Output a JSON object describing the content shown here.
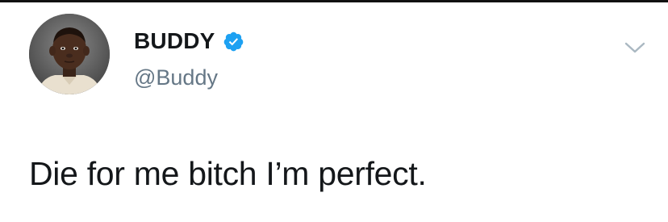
{
  "tweet": {
    "author": {
      "display_name": "BUDDY",
      "handle": "@Buddy",
      "verified": true,
      "avatar_icon": "profile-photo"
    },
    "text": "Die for me bitch I’m perfect.",
    "menu_icon": "chevron-down-icon"
  },
  "colors": {
    "name": "#14171a",
    "handle": "#657786",
    "verified_badge": "#1da1f2",
    "chevron": "#aab8c2",
    "top_rule": "#111111"
  }
}
